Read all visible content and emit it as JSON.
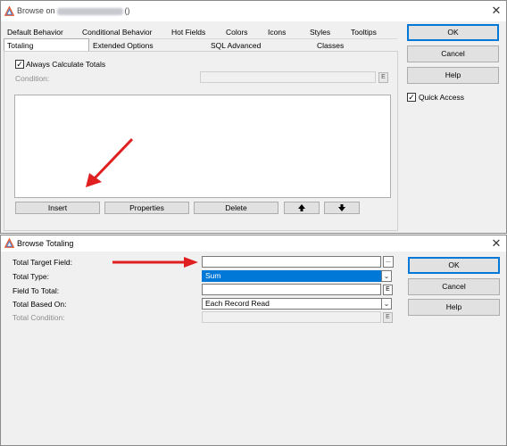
{
  "back_window": {
    "title_prefix": "Browse on",
    "title_suffix": "()",
    "tabs_row1": [
      "Default Behavior",
      "Conditional Behavior",
      "Hot Fields",
      "Colors",
      "Icons",
      "Styles",
      "Tooltips"
    ],
    "tabs_row2": [
      "Totaling",
      "Extended Options",
      "SQL Advanced",
      "Classes"
    ],
    "always_calculate_totals": "Always Calculate Totals",
    "condition_label": "Condition:",
    "e_label": "E",
    "buttons": {
      "insert": "Insert",
      "properties": "Properties",
      "delete": "Delete"
    },
    "side_buttons": {
      "ok": "OK",
      "cancel": "Cancel",
      "help": "Help"
    },
    "quick_access": "Quick Access"
  },
  "dialog": {
    "title": "Browse Totaling",
    "labels": {
      "total_target_field": "Total Target Field:",
      "total_type": "Total Type:",
      "field_to_total": "Field To Total:",
      "total_based_on": "Total Based On:",
      "total_condition": "Total Condition:"
    },
    "values": {
      "total_target_field": "",
      "total_type": "Sum",
      "field_to_total": "",
      "total_based_on": "Each Record Read",
      "total_condition": ""
    },
    "ellipsis": "...",
    "e_label": "E",
    "buttons": {
      "ok": "OK",
      "cancel": "Cancel",
      "help": "Help"
    }
  },
  "colors": {
    "accent": "#0078d7",
    "arrow": "#e02020",
    "window_bg": "#f0f0f0"
  }
}
